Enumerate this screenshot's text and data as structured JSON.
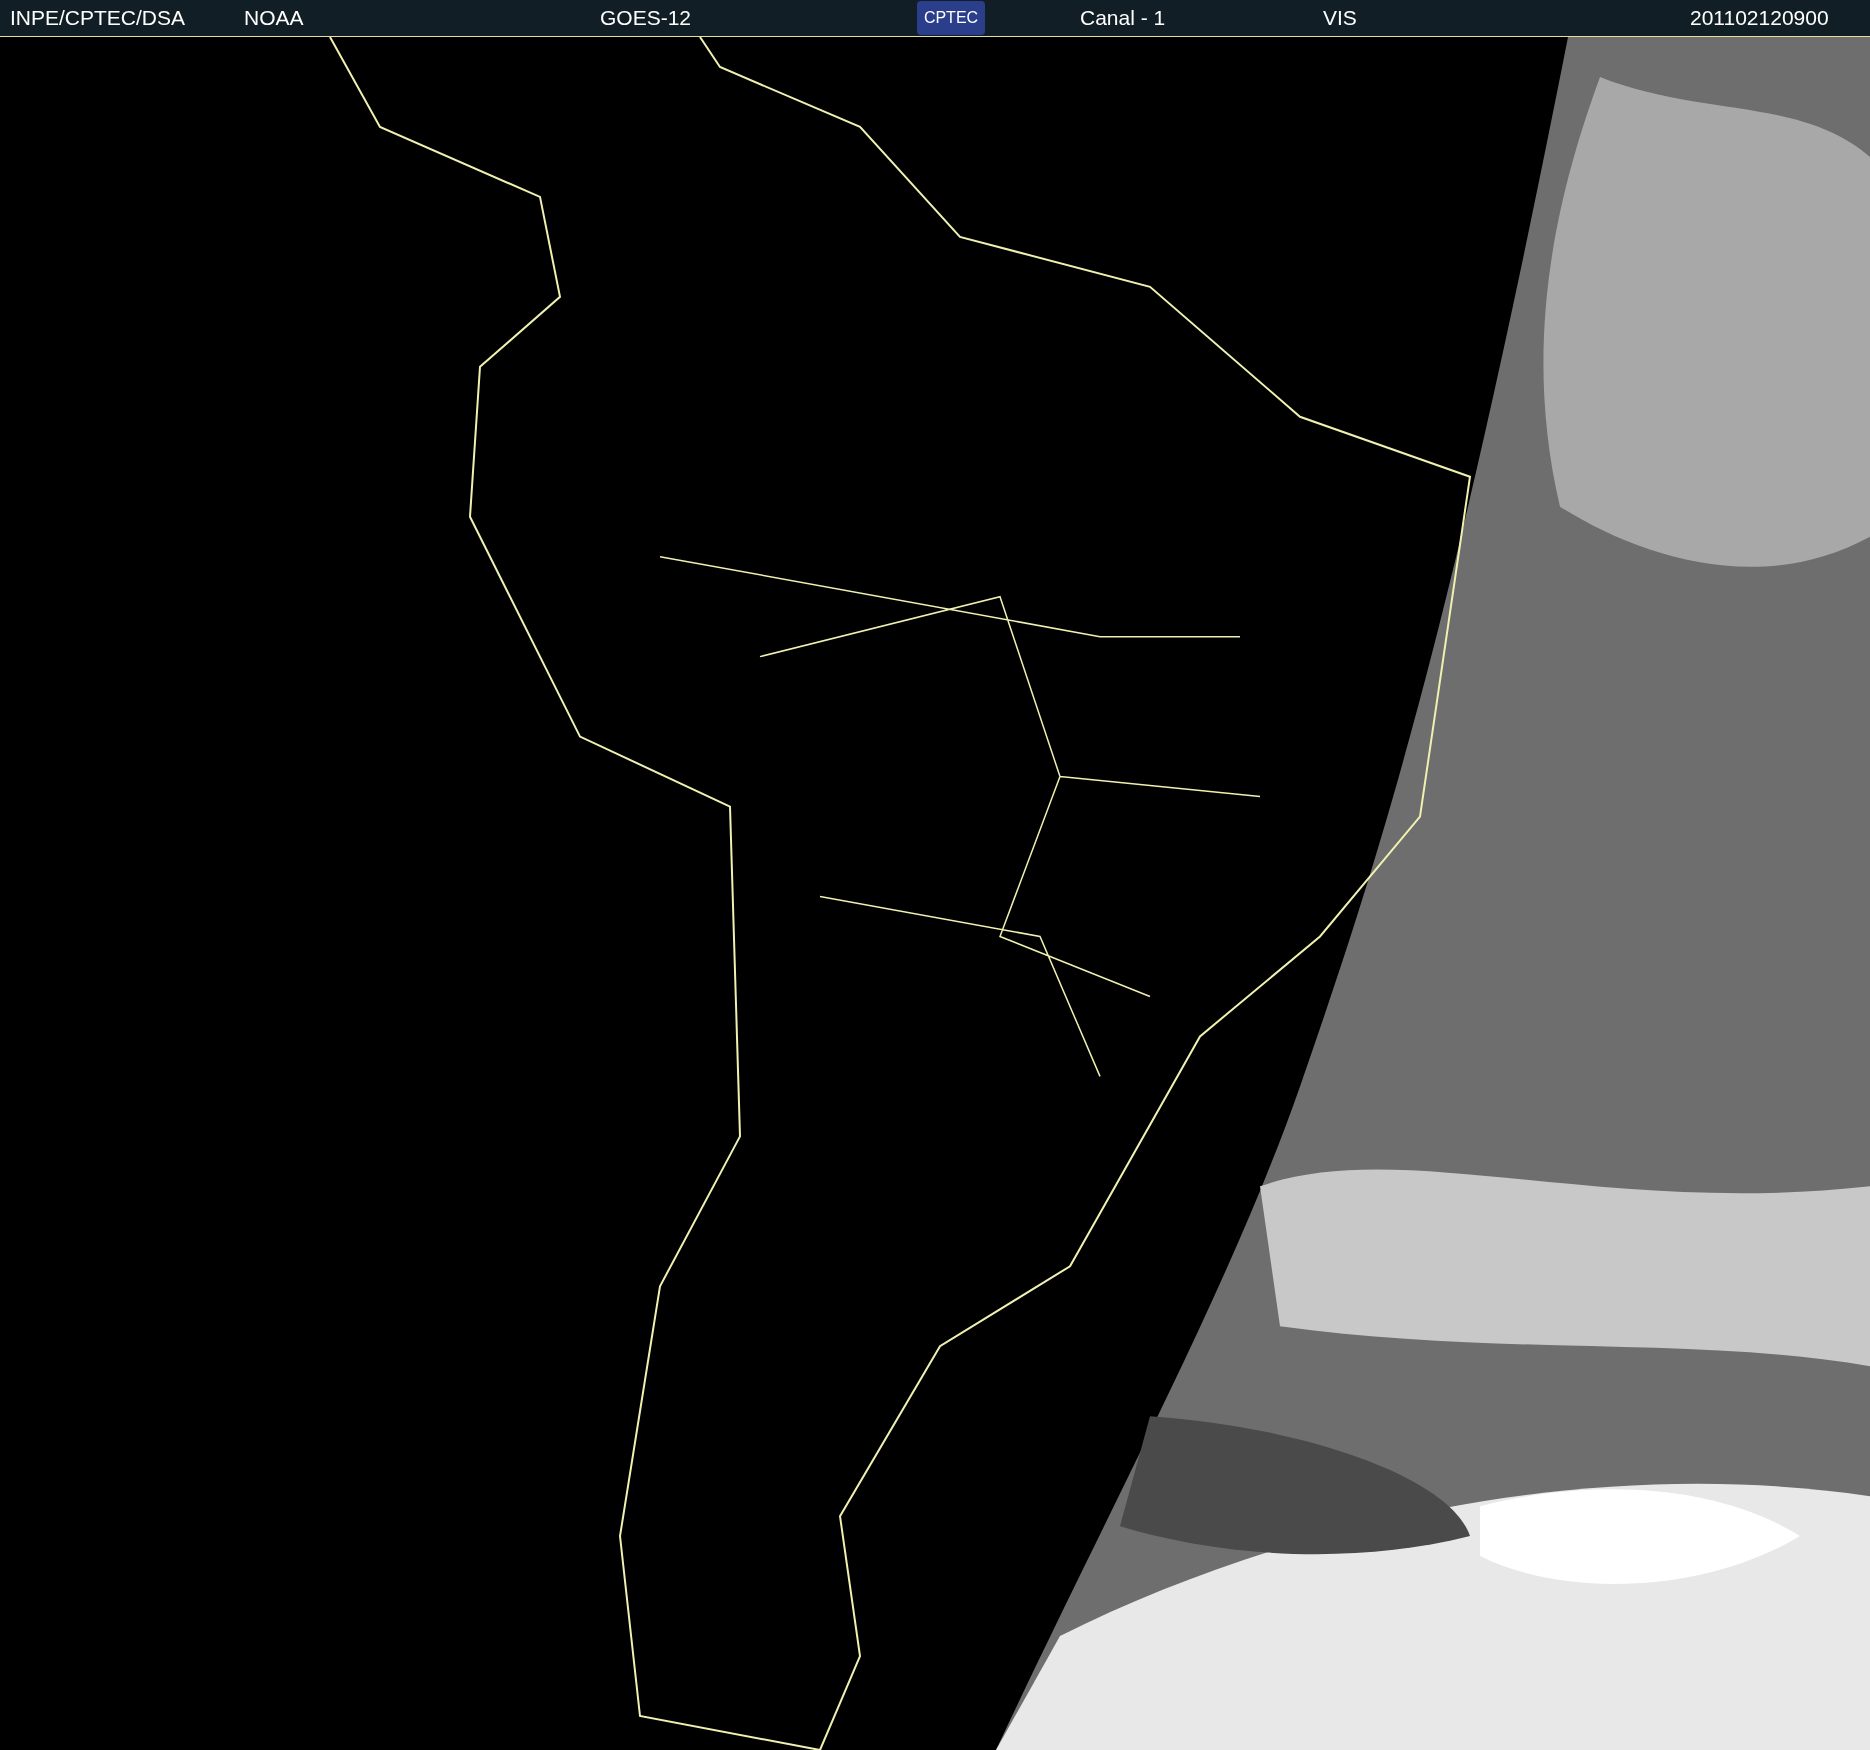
{
  "header": {
    "agency": "INPE/CPTEC/DSA",
    "source": "NOAA",
    "satellite": "GOES-12",
    "logo": "CPTEC",
    "channel": "Canal - 1",
    "band": "VIS",
    "timestamp": "201102120900"
  }
}
